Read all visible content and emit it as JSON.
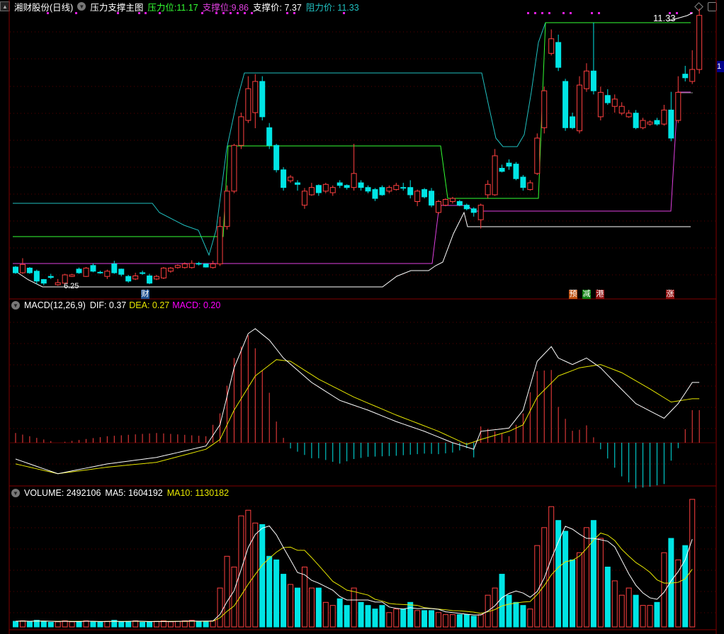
{
  "header": {
    "stock": "湘财股份(日线)",
    "indicator": "压力支撑主图",
    "pressure_label": "压力位:",
    "pressure": "11.17",
    "support_label": "支撑位:",
    "support": "9.86",
    "support_price_label": "支撑价:",
    "support_price": "7.37",
    "resist_price_label": "阻力价:",
    "resist_price": "11.33"
  },
  "price_labels": {
    "high": "11.33",
    "low": "6.25",
    "axis_tag": "1"
  },
  "markers": [
    {
      "text": "财",
      "color": "#1f4f8f"
    },
    {
      "text": "预",
      "color": "#c05010"
    },
    {
      "text": "减",
      "color": "#108010"
    },
    {
      "text": "港",
      "color": "#901010"
    },
    {
      "text": "涨",
      "color": "#901010"
    }
  ],
  "macd": {
    "title": "MACD(12,26,9)",
    "dif": "DIF: 0.37",
    "dea": "DEA: 0.27",
    "macd": "MACD: 0.20"
  },
  "volume": {
    "title": "VOLUME: 2492106",
    "ma5": "MA5: 1604192",
    "ma10": "MA10: 1130182"
  },
  "colors": {
    "up": "#ff4040",
    "down": "#00e5e5",
    "grid": "#800000",
    "dea": "#e6e600",
    "macd_label": "#ff00ff"
  },
  "candles": [
    [
      6.63,
      6.52,
      6.65,
      6.5
    ],
    [
      6.52,
      6.68,
      6.8,
      6.5
    ],
    [
      6.61,
      6.52,
      6.63,
      6.5
    ],
    [
      6.55,
      6.36,
      6.58,
      6.3
    ],
    [
      6.39,
      6.32,
      6.4,
      6.28
    ],
    [
      6.45,
      6.43,
      6.5,
      6.4
    ],
    [
      6.29,
      6.33,
      6.4,
      6.27
    ],
    [
      6.32,
      6.48,
      6.5,
      6.3
    ],
    [
      6.45,
      6.48,
      6.5,
      6.44
    ],
    [
      6.59,
      6.52,
      6.62,
      6.5
    ],
    [
      6.45,
      6.61,
      6.63,
      6.44
    ],
    [
      6.66,
      6.55,
      6.7,
      6.53
    ],
    [
      6.53,
      6.53,
      6.56,
      6.5
    ],
    [
      6.45,
      6.55,
      6.58,
      6.4
    ],
    [
      6.69,
      6.52,
      6.75,
      6.5
    ],
    [
      6.59,
      6.49,
      6.6,
      6.45
    ],
    [
      6.45,
      6.36,
      6.48,
      6.33
    ],
    [
      6.4,
      6.46,
      6.52,
      6.38
    ],
    [
      6.52,
      6.52,
      6.56,
      6.48
    ],
    [
      6.46,
      6.32,
      6.5,
      6.3
    ],
    [
      6.4,
      6.45,
      6.48,
      6.38
    ],
    [
      6.42,
      6.61,
      6.63,
      6.4
    ],
    [
      6.55,
      6.61,
      6.63,
      6.52
    ],
    [
      6.62,
      6.66,
      6.68,
      6.6
    ],
    [
      6.62,
      6.69,
      6.72,
      6.6
    ],
    [
      6.62,
      6.7,
      6.76,
      6.6
    ],
    [
      6.7,
      6.7,
      6.73,
      6.66
    ],
    [
      6.69,
      6.63,
      6.7,
      6.62
    ],
    [
      6.62,
      6.69,
      6.75,
      6.6
    ],
    [
      6.69,
      7.41,
      7.6,
      6.65
    ],
    [
      7.41,
      8.09,
      8.2,
      7.35
    ],
    [
      8.09,
      8.97,
      9.0,
      8.05
    ],
    [
      8.97,
      9.52,
      9.6,
      8.9
    ],
    [
      9.45,
      10.06,
      10.3,
      9.4
    ],
    [
      9.6,
      10.2,
      10.34,
      9.3
    ],
    [
      10.2,
      9.52,
      10.3,
      9.45
    ],
    [
      9.31,
      8.97,
      9.4,
      8.9
    ],
    [
      8.97,
      8.5,
      9.0,
      8.45
    ],
    [
      8.5,
      8.16,
      8.55,
      8.1
    ],
    [
      8.29,
      8.36,
      8.4,
      8.25
    ],
    [
      8.25,
      8.22,
      8.3,
      8.1
    ],
    [
      7.82,
      8.09,
      8.15,
      7.75
    ],
    [
      8.02,
      8.16,
      8.25,
      8.0
    ],
    [
      8.2,
      8.06,
      8.22,
      8.0
    ],
    [
      8.09,
      8.22,
      8.25,
      8.05
    ],
    [
      8.06,
      8.16,
      8.2,
      8.0
    ],
    [
      8.25,
      8.2,
      8.3,
      8.15
    ],
    [
      8.2,
      8.16,
      8.22,
      8.12
    ],
    [
      8.16,
      8.43,
      9.0,
      8.1
    ],
    [
      8.25,
      8.16,
      8.3,
      8.1
    ],
    [
      8.16,
      8.09,
      8.2,
      8.05
    ],
    [
      8.12,
      7.95,
      8.15,
      7.9
    ],
    [
      8.16,
      8.02,
      8.2,
      8.0
    ],
    [
      8.09,
      8.16,
      8.2,
      8.05
    ],
    [
      8.12,
      8.2,
      8.25,
      8.1
    ],
    [
      8.16,
      8.16,
      8.25,
      8.1
    ],
    [
      8.16,
      8.02,
      8.3,
      7.95
    ],
    [
      7.89,
      8.09,
      8.12,
      7.8
    ],
    [
      8.12,
      7.98,
      8.15,
      7.95
    ],
    [
      8.09,
      7.82,
      8.15,
      7.78
    ],
    [
      7.68,
      7.89,
      7.92,
      7.65
    ],
    [
      7.82,
      7.93,
      7.95,
      7.8
    ],
    [
      7.89,
      7.95,
      7.98,
      7.85
    ],
    [
      7.89,
      7.82,
      7.92,
      7.8
    ],
    [
      7.82,
      7.75,
      7.85,
      7.72
    ],
    [
      7.75,
      7.68,
      7.78,
      7.6
    ],
    [
      7.54,
      7.82,
      7.85,
      7.37
    ],
    [
      8.02,
      8.22,
      8.3,
      7.95
    ],
    [
      8.02,
      8.77,
      8.9,
      8.0
    ],
    [
      8.53,
      8.47,
      8.6,
      8.45
    ],
    [
      8.63,
      8.57,
      8.7,
      8.5
    ],
    [
      8.61,
      8.33,
      8.65,
      8.3
    ],
    [
      8.36,
      8.16,
      8.4,
      8.1
    ],
    [
      8.12,
      8.25,
      8.3,
      8.1
    ],
    [
      8.43,
      9.11,
      9.2,
      8.4
    ],
    [
      9.31,
      10.02,
      10.1,
      9.2
    ],
    [
      10.74,
      11.02,
      11.2,
      10.7
    ],
    [
      10.95,
      10.47,
      11.1,
      10.4
    ],
    [
      10.2,
      9.31,
      10.25,
      9.25
    ],
    [
      9.52,
      9.31,
      9.6,
      9.28
    ],
    [
      9.25,
      10.13,
      10.3,
      9.2
    ],
    [
      10.06,
      10.4,
      10.55,
      10.0
    ],
    [
      10.4,
      10.02,
      11.33,
      9.95
    ],
    [
      9.52,
      9.99,
      10.1,
      9.45
    ],
    [
      9.93,
      9.79,
      10.05,
      9.75
    ],
    [
      9.72,
      9.86,
      9.95,
      9.6
    ],
    [
      9.59,
      9.72,
      9.8,
      9.55
    ],
    [
      9.52,
      9.59,
      9.65,
      9.5
    ],
    [
      9.59,
      9.31,
      9.65,
      9.28
    ],
    [
      9.31,
      9.45,
      9.5,
      9.28
    ],
    [
      9.38,
      9.42,
      9.45,
      9.35
    ],
    [
      9.45,
      9.38,
      9.5,
      9.35
    ],
    [
      9.38,
      9.65,
      9.75,
      9.35
    ],
    [
      9.65,
      9.11,
      10.0,
      9.05
    ],
    [
      9.45,
      9.99,
      10.3,
      9.4
    ],
    [
      10.34,
      10.27,
      10.5,
      10.2
    ],
    [
      10.2,
      10.43,
      10.8,
      10.15
    ],
    [
      10.43,
      11.47,
      11.6,
      10.35
    ]
  ],
  "dif": [
    [
      0,
      -0.1
    ],
    [
      6,
      -0.19
    ],
    [
      13,
      -0.13
    ],
    [
      20,
      -0.09
    ],
    [
      27,
      -0.02
    ],
    [
      29,
      0.11
    ],
    [
      31,
      0.46
    ],
    [
      33,
      0.67
    ],
    [
      34,
      0.7
    ],
    [
      36,
      0.63
    ],
    [
      38,
      0.52
    ],
    [
      42,
      0.37
    ],
    [
      46,
      0.26
    ],
    [
      50,
      0.2
    ],
    [
      54,
      0.13
    ],
    [
      58,
      0.07
    ],
    [
      62,
      0.0
    ],
    [
      65,
      -0.04
    ],
    [
      66,
      0.07
    ],
    [
      70,
      0.09
    ],
    [
      72,
      0.2
    ],
    [
      74,
      0.5
    ],
    [
      76,
      0.59
    ],
    [
      77,
      0.52
    ],
    [
      79,
      0.48
    ],
    [
      81,
      0.52
    ],
    [
      83,
      0.46
    ],
    [
      85,
      0.37
    ],
    [
      88,
      0.24
    ],
    [
      92,
      0.15
    ],
    [
      94,
      0.24
    ],
    [
      96,
      0.37
    ]
  ],
  "dea": [
    [
      0,
      -0.13
    ],
    [
      6,
      -0.19
    ],
    [
      13,
      -0.15
    ],
    [
      20,
      -0.12
    ],
    [
      27,
      -0.04
    ],
    [
      29,
      0.02
    ],
    [
      31,
      0.2
    ],
    [
      34,
      0.41
    ],
    [
      37,
      0.51
    ],
    [
      39,
      0.5
    ],
    [
      43,
      0.39
    ],
    [
      48,
      0.28
    ],
    [
      54,
      0.17
    ],
    [
      60,
      0.07
    ],
    [
      64,
      -0.01
    ],
    [
      66,
      0.02
    ],
    [
      70,
      0.07
    ],
    [
      72,
      0.11
    ],
    [
      74,
      0.28
    ],
    [
      77,
      0.41
    ],
    [
      80,
      0.46
    ],
    [
      83,
      0.48
    ],
    [
      86,
      0.43
    ],
    [
      90,
      0.33
    ],
    [
      93,
      0.25
    ],
    [
      96,
      0.27
    ]
  ],
  "volumes": [
    110000,
    120000,
    100000,
    130000,
    110000,
    90000,
    100000,
    120000,
    100000,
    110000,
    120000,
    100000,
    90000,
    110000,
    130000,
    100000,
    110000,
    120000,
    90000,
    100000,
    110000,
    120000,
    100000,
    110000,
    120000,
    130000,
    100000,
    110000,
    120000,
    760000,
    1380000,
    1170000,
    2170000,
    2280000,
    2030000,
    2000000,
    1380000,
    1310000,
    1030000,
    830000,
    760000,
    1170000,
    760000,
    760000,
    480000,
    420000,
    550000,
    420000,
    760000,
    480000,
    420000,
    350000,
    420000,
    280000,
    350000,
    350000,
    480000,
    320000,
    320000,
    320000,
    280000,
    240000,
    240000,
    240000,
    240000,
    210000,
    240000,
    620000,
    760000,
    1030000,
    620000,
    480000,
    420000,
    350000,
    1590000,
    1940000,
    2350000,
    2080000,
    1870000,
    1310000,
    1450000,
    1940000,
    2080000,
    1730000,
    1170000,
    900000,
    620000,
    760000,
    620000,
    420000,
    420000,
    480000,
    1450000,
    1730000,
    1310000,
    1590000,
    2492106
  ]
}
